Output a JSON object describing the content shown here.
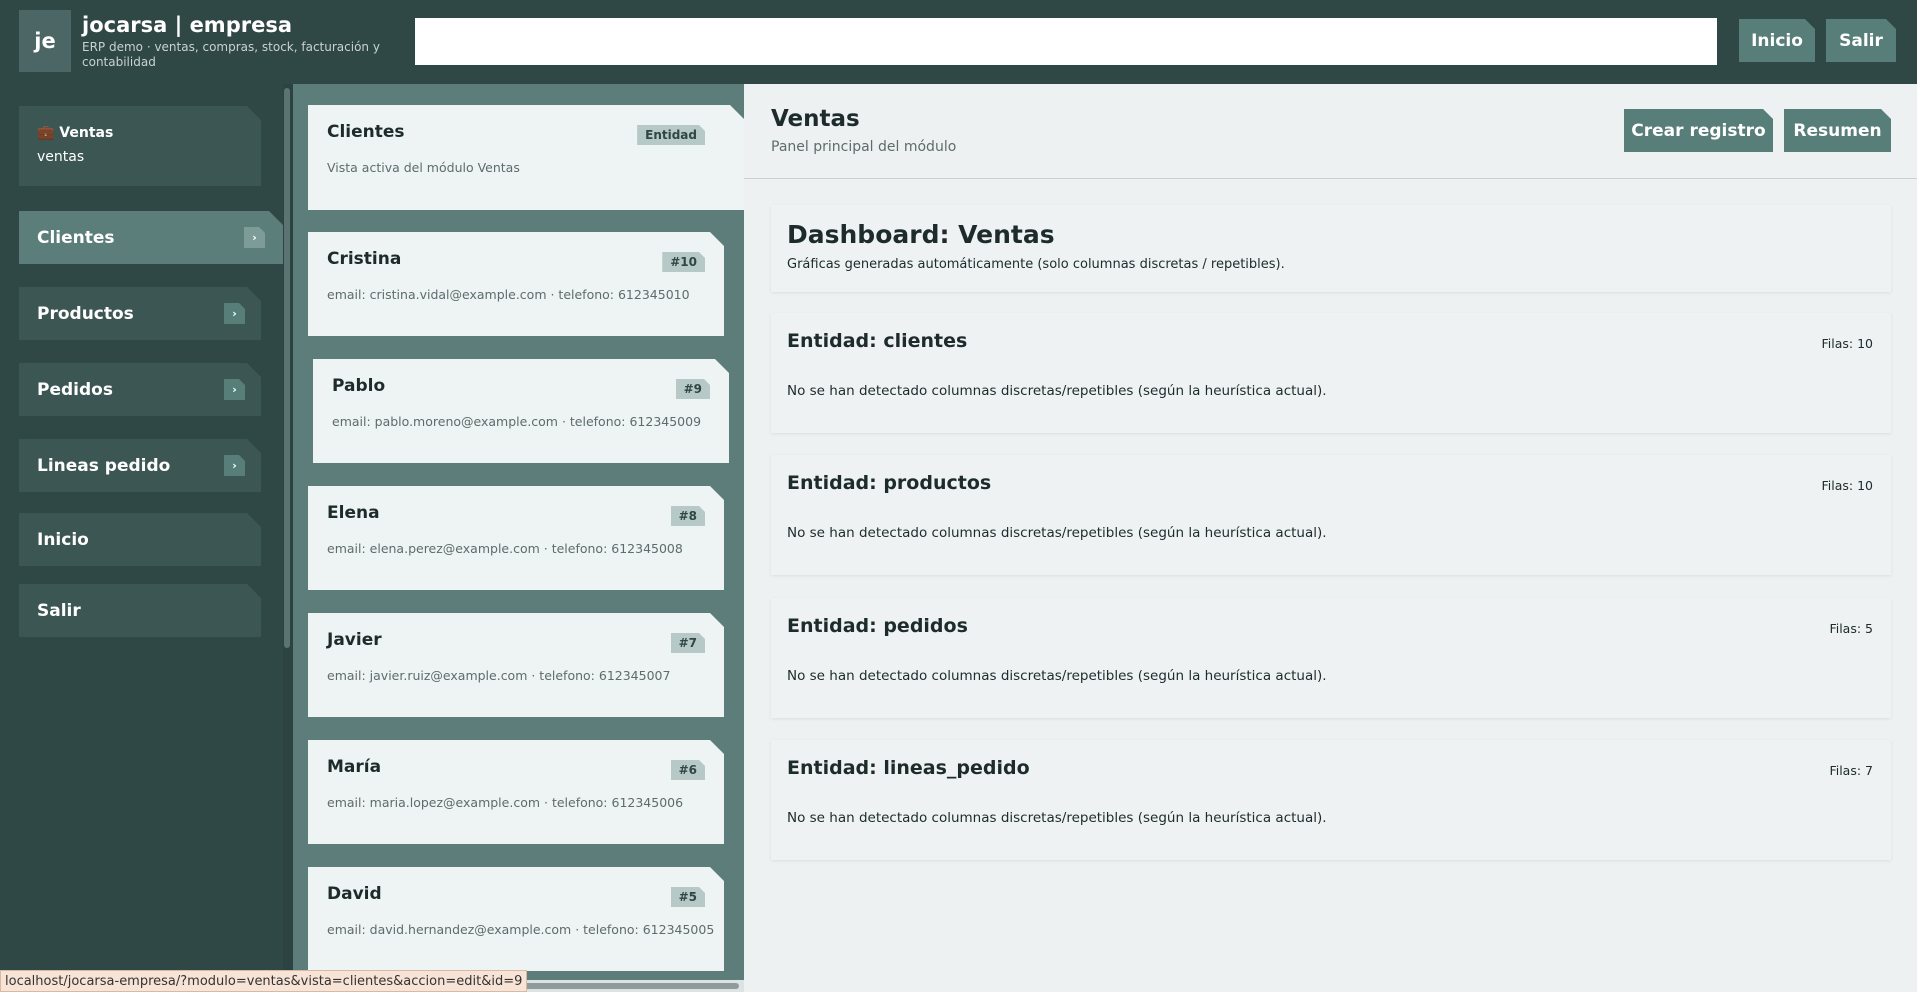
{
  "header": {
    "logo": "je",
    "title": "jocarsa | empresa",
    "subtitle": "ERP demo · ventas, compras, stock, facturación y contabilidad",
    "search_value": "",
    "inicio_label": "Inicio",
    "salir_label": "Salir"
  },
  "sidebar": {
    "module_icon": "briefcase-icon",
    "module_title": "💼 Ventas",
    "module_sub": "ventas",
    "items": [
      {
        "label": "Clientes",
        "active": true,
        "chevron": "›"
      },
      {
        "label": "Productos",
        "active": false,
        "chevron": "›"
      },
      {
        "label": "Pedidos",
        "active": false,
        "chevron": "›"
      },
      {
        "label": "Lineas pedido",
        "active": false,
        "chevron": "›"
      },
      {
        "label": "Inicio",
        "active": false
      },
      {
        "label": "Salir",
        "active": false
      }
    ]
  },
  "list": {
    "head": {
      "name": "Clientes",
      "badge": "Entidad",
      "desc": "Vista activa del módulo Ventas"
    },
    "records": [
      {
        "name": "Cristina",
        "badge": "#10",
        "desc": "email: cristina.vidal@example.com · telefono: 612345010"
      },
      {
        "name": "Pablo",
        "badge": "#9",
        "desc": "email: pablo.moreno@example.com · telefono: 612345009"
      },
      {
        "name": "Elena",
        "badge": "#8",
        "desc": "email: elena.perez@example.com · telefono: 612345008"
      },
      {
        "name": "Javier",
        "badge": "#7",
        "desc": "email: javier.ruiz@example.com · telefono: 612345007"
      },
      {
        "name": "María",
        "badge": "#6",
        "desc": "email: maria.lopez@example.com · telefono: 612345006"
      },
      {
        "name": "David",
        "badge": "#5",
        "desc": "email: david.hernandez@example.com · telefono: 612345005"
      }
    ]
  },
  "main": {
    "title": "Ventas",
    "subtitle": "Panel principal del módulo",
    "crear_label": "Crear registro",
    "resumen_label": "Resumen",
    "dashboard": {
      "title": "Dashboard: Ventas",
      "subtitle": "Gráficas generadas automáticamente (solo columnas discretas / repetibles)."
    },
    "entities": [
      {
        "title": "Entidad: clientes",
        "filas": "Filas: 10",
        "msg": "No se han detectado columnas discretas/repetibles (según la heurística actual)."
      },
      {
        "title": "Entidad: productos",
        "filas": "Filas: 10",
        "msg": "No se han detectado columnas discretas/repetibles (según la heurística actual)."
      },
      {
        "title": "Entidad: pedidos",
        "filas": "Filas: 5",
        "msg": "No se han detectado columnas discretas/repetibles (según la heurística actual)."
      },
      {
        "title": "Entidad: lineas_pedido",
        "filas": "Filas: 7",
        "msg": "No se han detectado columnas discretas/repetibles (según la heurística actual)."
      }
    ]
  },
  "statusbar": {
    "url": "localhost/jocarsa-empresa/?modulo=ventas&vista=clientes&accion=edit&id=9"
  }
}
